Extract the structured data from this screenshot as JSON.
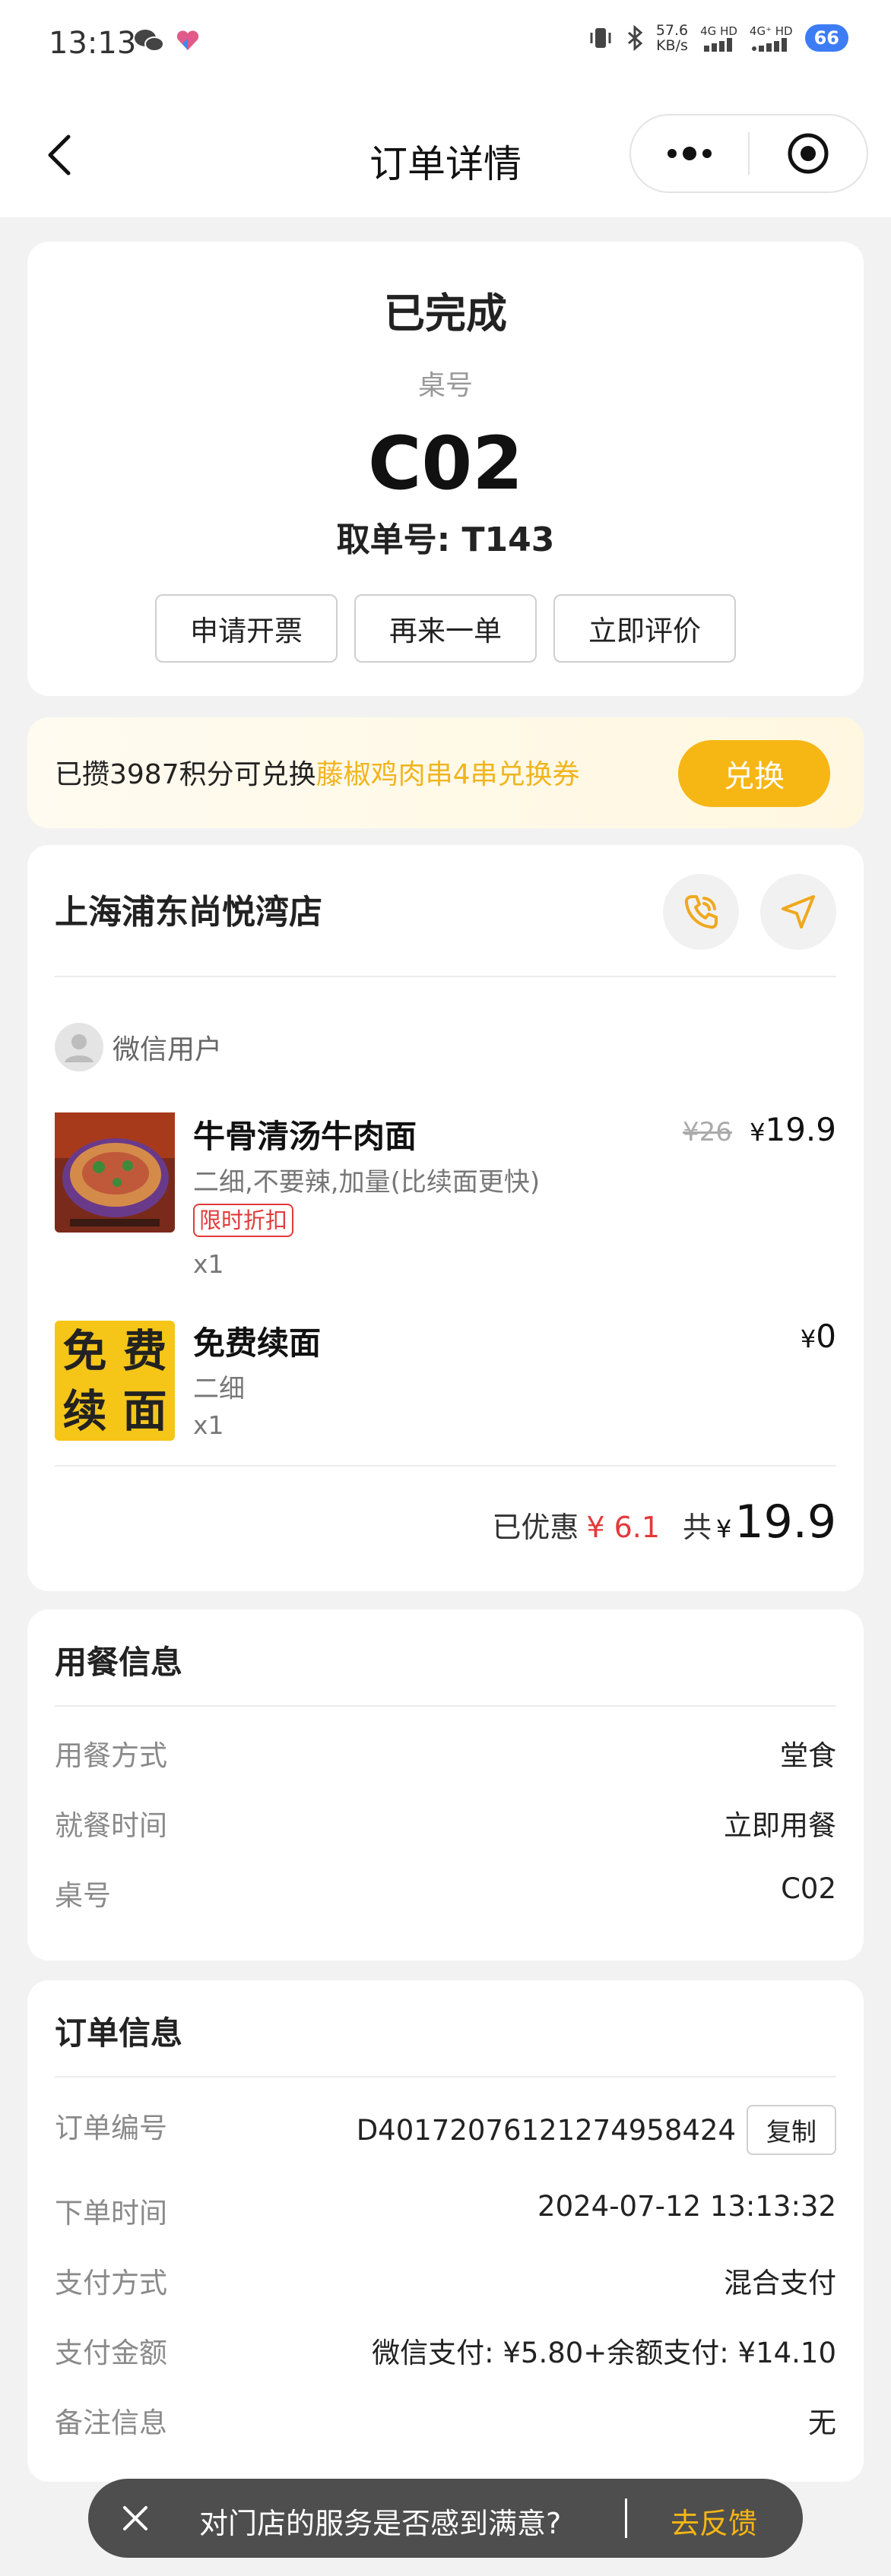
{
  "status": {
    "time": "13:13",
    "net_speed_value": "57.6",
    "net_speed_unit": "KB/s",
    "sim1": "4G HD",
    "sim2": "4G⁺ HD",
    "battery": "66"
  },
  "nav": {
    "title": "订单详情"
  },
  "order": {
    "status": "已完成",
    "table_label": "桌号",
    "table_no": "C02",
    "pickup": "取单号: T143",
    "actions": [
      "申请开票",
      "再来一单",
      "立即评价"
    ]
  },
  "points": {
    "prefix": "已攒3987积分可兑换",
    "reward": "藤椒鸡肉串4串兑换券",
    "button": "兑换"
  },
  "store": {
    "name": "上海浦东尚悦湾店",
    "user": "微信用户",
    "items": [
      {
        "name": "牛骨清汤牛肉面",
        "options": "二细,不要辣,加量(比续面更快)",
        "tag": "限时折扣",
        "qty": "x1",
        "original_price": "¥26",
        "price_symbol": "¥",
        "price": "19.9"
      },
      {
        "name": "免费续面",
        "options": "二细",
        "qty": "x1",
        "price_symbol": "¥",
        "price": "0",
        "image_text": "免费续面"
      }
    ],
    "discount_label": "已优惠",
    "discount_value": "¥ 6.1",
    "total_label": "共",
    "total_symbol": "¥",
    "total_value": "19.9"
  },
  "dining": {
    "title": "用餐信息",
    "rows": [
      {
        "label": "用餐方式",
        "value": "堂食"
      },
      {
        "label": "就餐时间",
        "value": "立即用餐"
      },
      {
        "label": "桌号",
        "value": "C02"
      }
    ]
  },
  "order_info": {
    "title": "订单信息",
    "copy_button": "复制",
    "rows": [
      {
        "label": "订单编号",
        "value": "D40172076121274958424"
      },
      {
        "label": "下单时间",
        "value": "2024-07-12 13:13:32"
      },
      {
        "label": "支付方式",
        "value": "混合支付"
      },
      {
        "label": "支付金额",
        "value": "微信支付: ¥5.80+余额支付: ¥14.10"
      },
      {
        "label": "备注信息",
        "value": "无"
      }
    ]
  },
  "toast": {
    "text": "对门店的服务是否感到满意?",
    "action": "去反馈"
  },
  "colors": {
    "accent": "#f6b614",
    "price_red": "#e23a3a",
    "page_bg": "#f2f2f2"
  }
}
